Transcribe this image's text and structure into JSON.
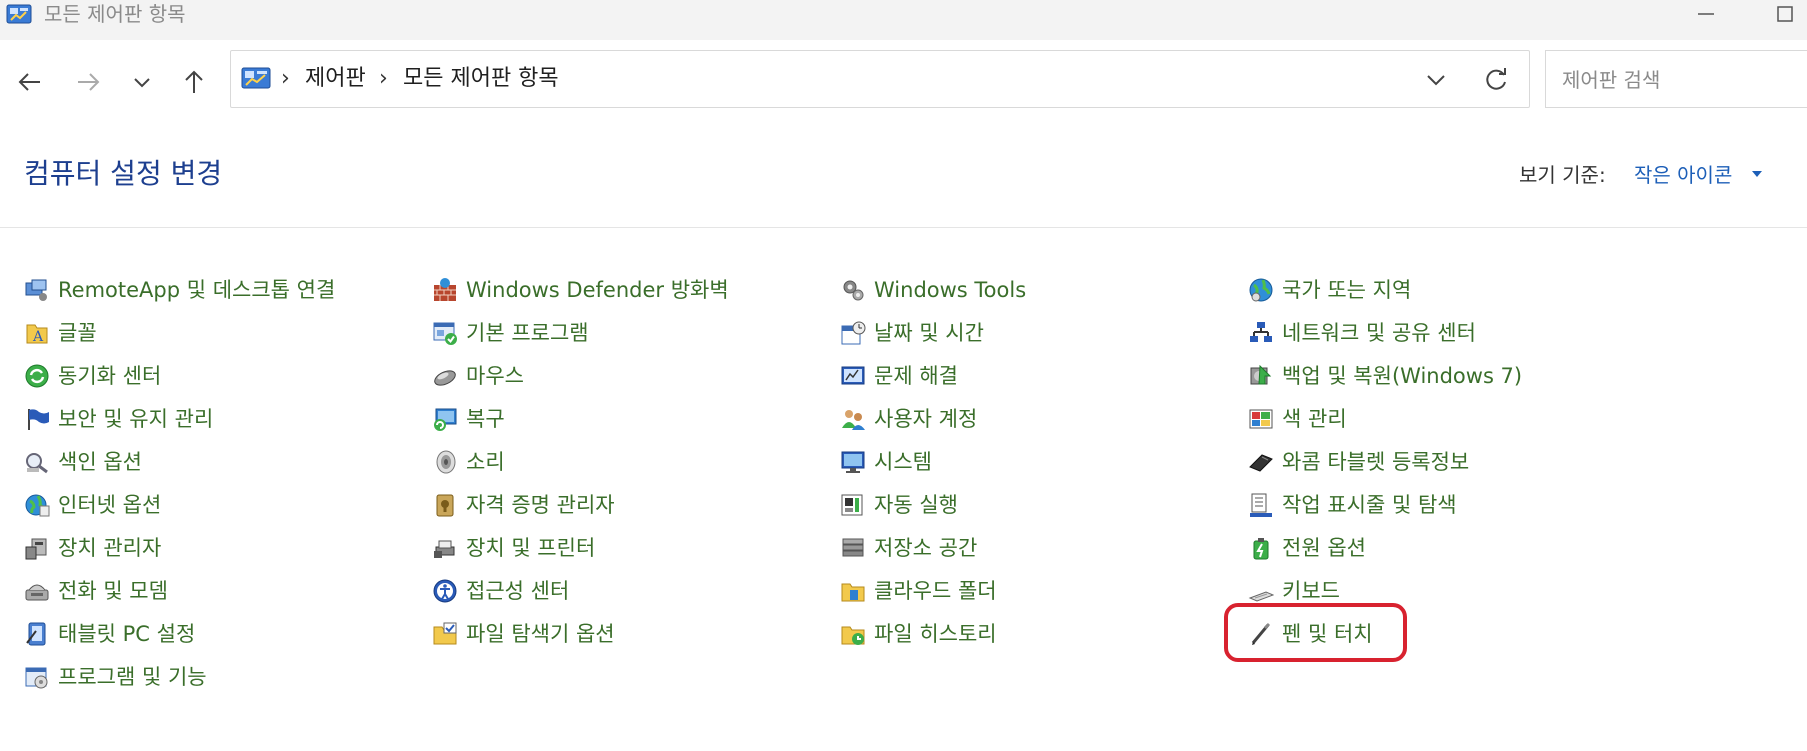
{
  "window": {
    "title": "모든 제어판 항목"
  },
  "address": {
    "crumbs": [
      "제어판",
      "모든 제어판 항목"
    ]
  },
  "search": {
    "placeholder": "제어판 검색"
  },
  "header": {
    "title": "컴퓨터 설정 변경",
    "view_label": "보기 기준:",
    "view_value": "작은 아이콘"
  },
  "columns": [
    {
      "items": [
        {
          "label": "RemoteApp 및 데스크톱 연결",
          "icon": "remote-desktop-icon"
        },
        {
          "label": "글꼴",
          "icon": "fonts-folder-icon"
        },
        {
          "label": "동기화 센터",
          "icon": "sync-center-icon"
        },
        {
          "label": "보안 및 유지 관리",
          "icon": "security-flag-icon"
        },
        {
          "label": "색인 옵션",
          "icon": "indexing-icon"
        },
        {
          "label": "인터넷 옵션",
          "icon": "internet-globe-icon"
        },
        {
          "label": "장치 관리자",
          "icon": "device-manager-icon"
        },
        {
          "label": "전화 및 모뎀",
          "icon": "phone-modem-icon"
        },
        {
          "label": "태블릿 PC 설정",
          "icon": "tablet-pc-icon"
        },
        {
          "label": "프로그램 및 기능",
          "icon": "programs-features-icon"
        }
      ]
    },
    {
      "items": [
        {
          "label": "Windows Defender 방화벽",
          "icon": "firewall-icon"
        },
        {
          "label": "기본 프로그램",
          "icon": "default-programs-icon"
        },
        {
          "label": "마우스",
          "icon": "mouse-icon"
        },
        {
          "label": "복구",
          "icon": "recovery-icon"
        },
        {
          "label": "소리",
          "icon": "speaker-icon"
        },
        {
          "label": "자격 증명 관리자",
          "icon": "credential-vault-icon"
        },
        {
          "label": "장치 및 프린터",
          "icon": "devices-printers-icon"
        },
        {
          "label": "접근성 센터",
          "icon": "ease-of-access-icon"
        },
        {
          "label": "파일 탐색기 옵션",
          "icon": "folder-options-icon"
        }
      ]
    },
    {
      "items": [
        {
          "label": "Windows Tools",
          "icon": "windows-tools-gear-icon"
        },
        {
          "label": "날짜 및 시간",
          "icon": "date-time-icon"
        },
        {
          "label": "문제 해결",
          "icon": "troubleshooting-icon"
        },
        {
          "label": "사용자 계정",
          "icon": "user-accounts-icon"
        },
        {
          "label": "시스템",
          "icon": "system-monitor-icon"
        },
        {
          "label": "자동 실행",
          "icon": "autoplay-icon"
        },
        {
          "label": "저장소 공간",
          "icon": "storage-spaces-icon"
        },
        {
          "label": "클라우드 폴더",
          "icon": "work-folders-icon"
        },
        {
          "label": "파일 히스토리",
          "icon": "file-history-icon"
        }
      ]
    },
    {
      "items": [
        {
          "label": "국가 또는 지역",
          "icon": "region-globe-icon"
        },
        {
          "label": "네트워크 및 공유 센터",
          "icon": "network-sharing-icon"
        },
        {
          "label": "백업 및 복원(Windows 7)",
          "icon": "backup-restore-icon"
        },
        {
          "label": "색 관리",
          "icon": "color-management-icon"
        },
        {
          "label": "와콤 타블렛 등록정보",
          "icon": "wacom-tablet-icon"
        },
        {
          "label": "작업 표시줄 및 탐색",
          "icon": "taskbar-navigation-icon"
        },
        {
          "label": "전원 옵션",
          "icon": "power-options-icon"
        },
        {
          "label": "키보드",
          "icon": "keyboard-icon"
        },
        {
          "label": "펜 및 터치",
          "icon": "pen-icon"
        }
      ]
    }
  ],
  "highlight": {
    "item": "펜 및 터치",
    "color": "#d8222f"
  },
  "colors": {
    "link": "#3a6e2a",
    "title": "#1d3f8f",
    "view_value": "#1d5fb8",
    "titlebar_bg": "#f3f3f3"
  }
}
